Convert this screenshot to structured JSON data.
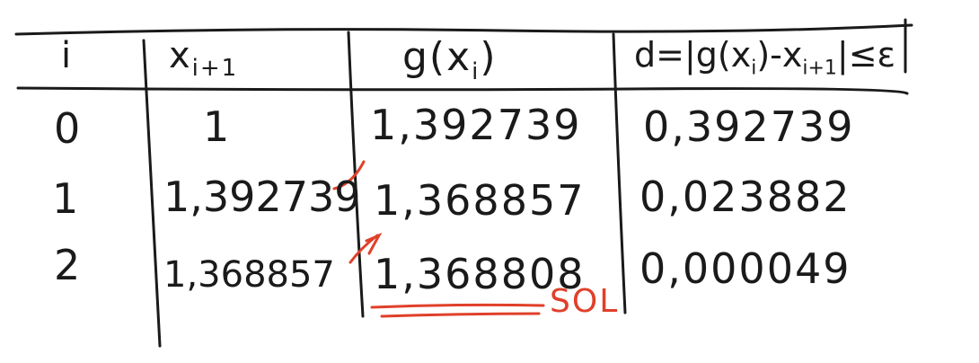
{
  "table": {
    "headers": {
      "i": "i",
      "x_next": "x",
      "x_next_sub": "i+1",
      "g": "g(x",
      "g_sub": "i",
      "g_close": ")",
      "d": "d=|g(x",
      "d_sub": "i",
      "d_mid": ")-x",
      "d_sub2": "i+1",
      "d_end": "|≤ε"
    },
    "rows": [
      {
        "i": "0",
        "x_next": "1",
        "g": "1,392739",
        "d": "0,392739"
      },
      {
        "i": "1",
        "x_next": "1,392739",
        "g": "1,368857",
        "d": "0,023882"
      },
      {
        "i": "2",
        "x_next": "1,368857",
        "g": "1,368808",
        "d": "0,000049"
      }
    ]
  },
  "annotations": {
    "solution_label": "SOL",
    "ink_color": "#1a1a1a",
    "accent_color": "#e0402a"
  }
}
